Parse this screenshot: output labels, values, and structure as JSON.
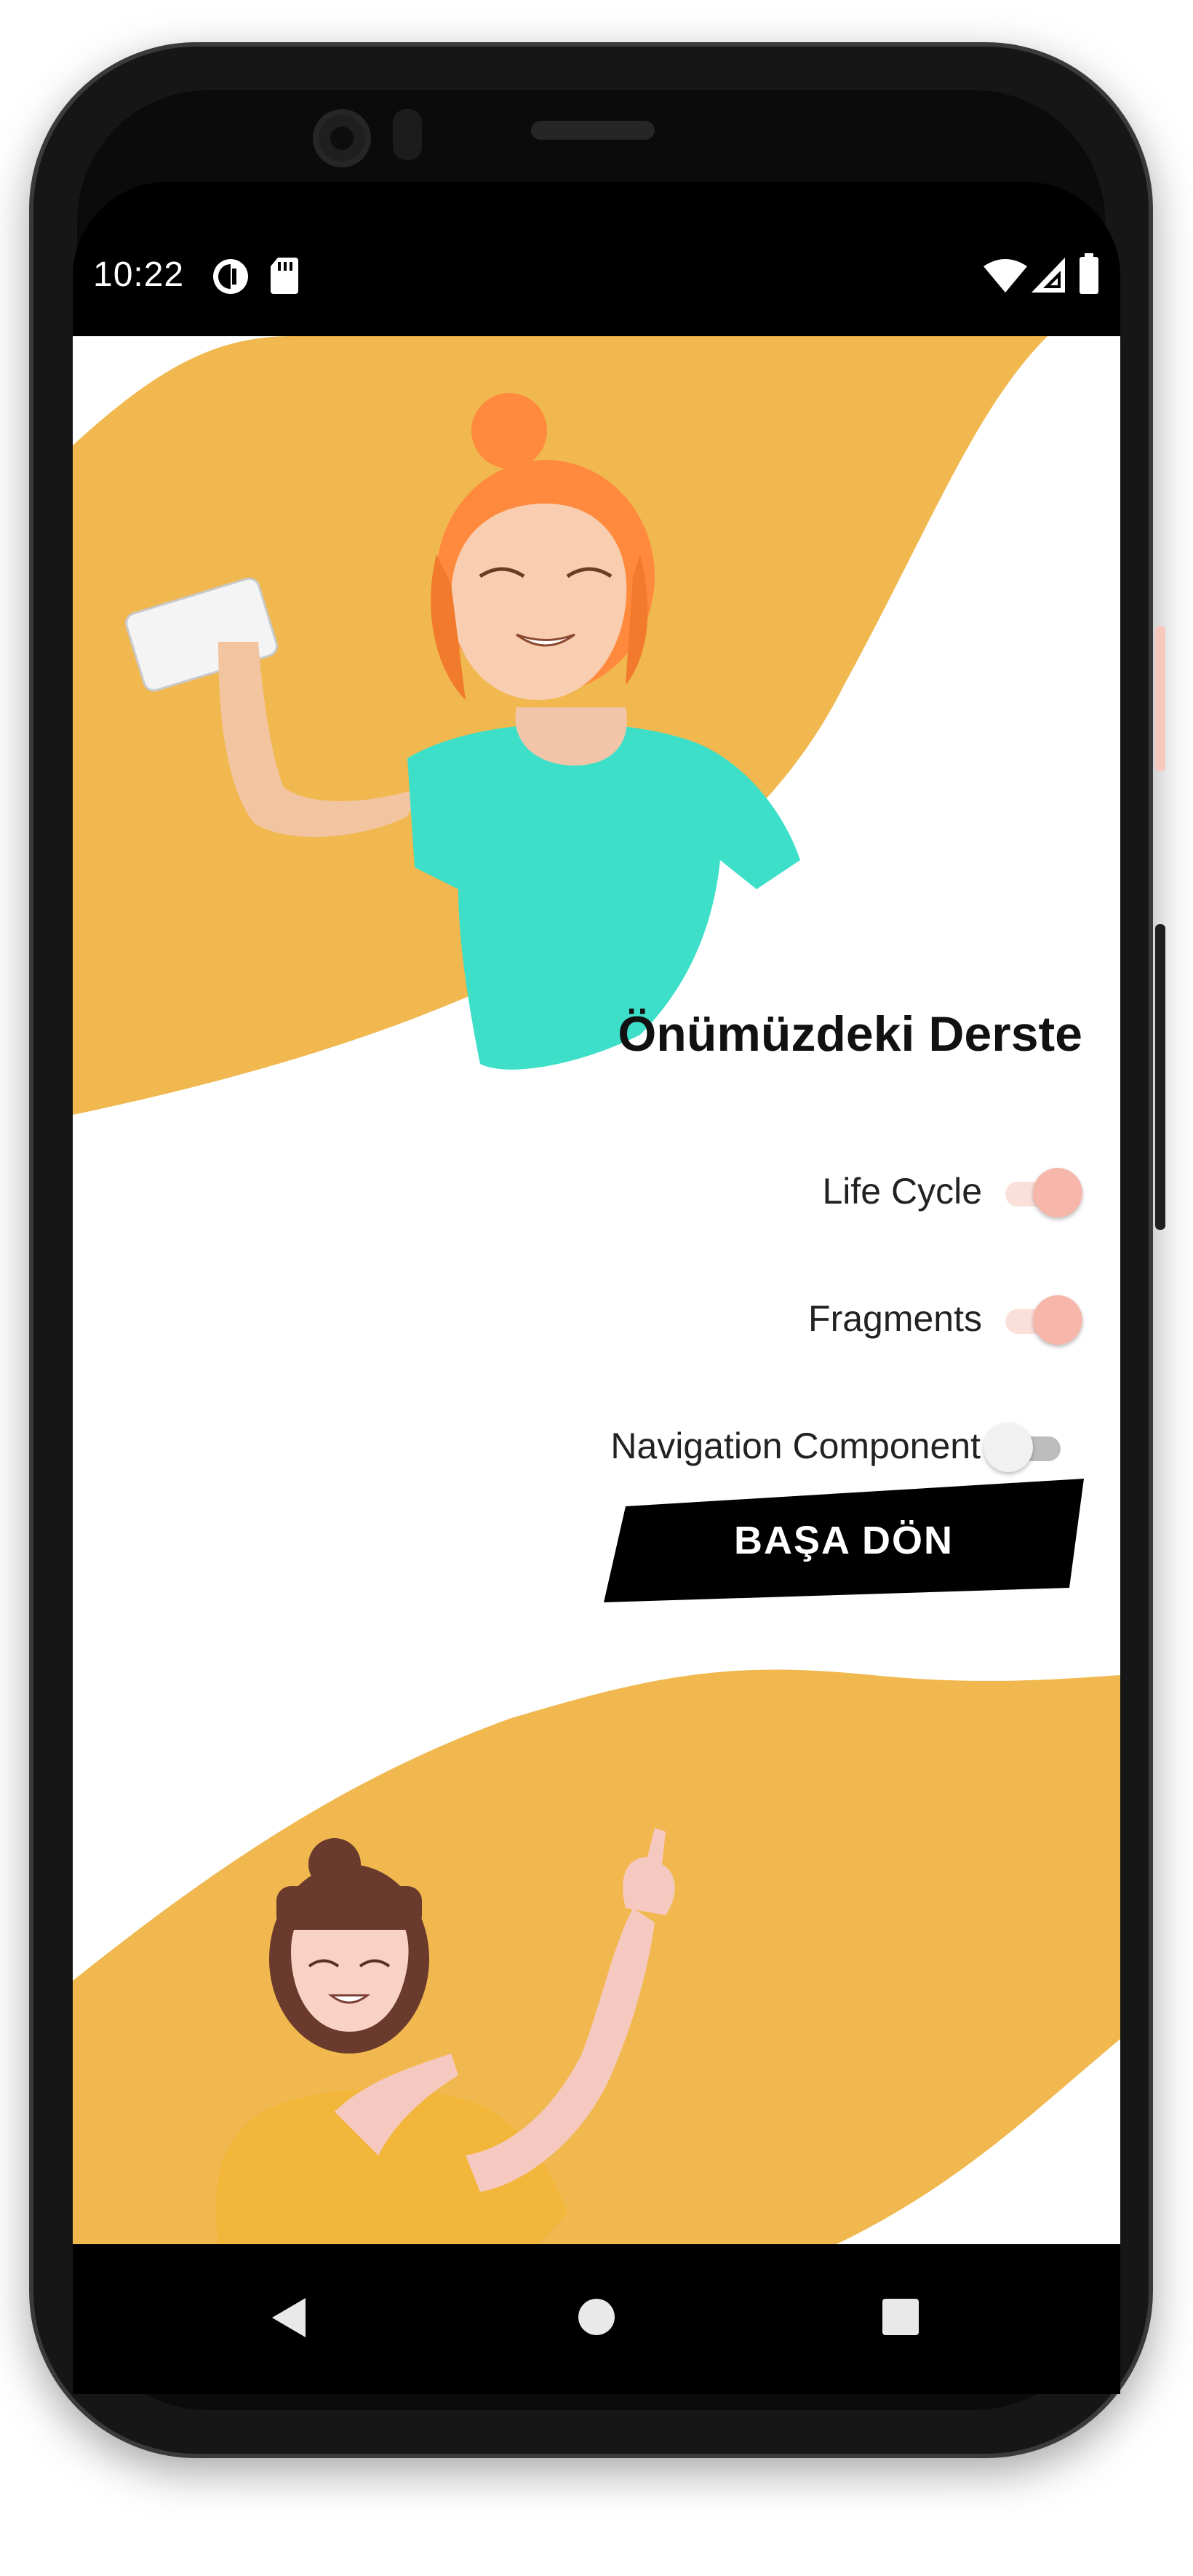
{
  "status_bar": {
    "time": "10:22",
    "left_icons": [
      "data-saver-icon",
      "sd-card-icon"
    ],
    "right_icons": [
      "wifi-icon",
      "signal-icon",
      "battery-icon"
    ]
  },
  "screen": {
    "title": "Önümüzdeki Derste",
    "toggles": [
      {
        "label": "Life Cycle",
        "checked": true
      },
      {
        "label": "Fragments",
        "checked": true
      },
      {
        "label": "Navigation Component",
        "checked": false
      }
    ],
    "button_label": "BAŞA DÖN"
  },
  "nav_bar": {
    "icons": [
      "back-icon",
      "home-icon",
      "recents-icon"
    ]
  },
  "colors": {
    "accent_yellow": "#f0b84f",
    "switch_on": "#f6b6aa",
    "button_bg": "#000000",
    "button_text": "#ffffff"
  }
}
